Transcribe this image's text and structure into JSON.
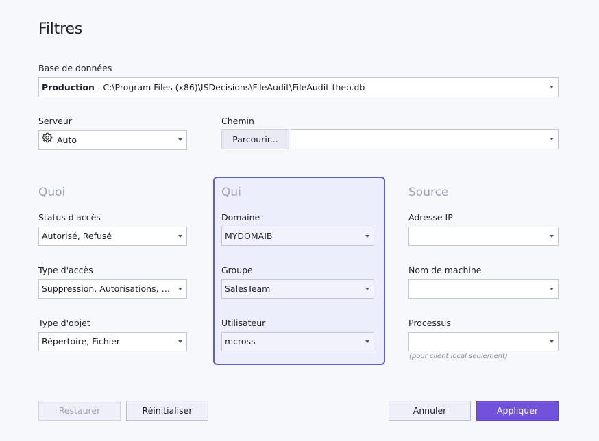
{
  "window": {
    "title": "Filtres"
  },
  "database": {
    "label": "Base de données",
    "name": "Production",
    "separator": " - ",
    "path": "C:\\Program Files (x86)\\ISDecisions\\FileAudit\\FileAudit-theo.db"
  },
  "server": {
    "label": "Serveur",
    "value": "Auto",
    "icon": "gear-icon"
  },
  "path": {
    "label": "Chemin",
    "browse_label": "Parcourir...",
    "value": ""
  },
  "quoi": {
    "title": "Quoi",
    "access_status": {
      "label": "Status d'accès",
      "value": "Autorisé, Refusé"
    },
    "access_type": {
      "label": "Type d'accès",
      "value": "Suppression, Autorisations, Ecriture"
    },
    "object_type": {
      "label": "Type d'objet",
      "value": "Répertoire, Fichier"
    }
  },
  "qui": {
    "title": "Qui",
    "domain": {
      "label": "Domaine",
      "value": "MYDOMAIB"
    },
    "group": {
      "label": "Groupe",
      "value": "SalesTeam"
    },
    "user": {
      "label": "Utilisateur",
      "value": "mcross"
    }
  },
  "source": {
    "title": "Source",
    "ip": {
      "label": "Adresse IP",
      "value": ""
    },
    "machine": {
      "label": "Nom de machine",
      "value": ""
    },
    "process": {
      "label": "Processus",
      "value": "",
      "hint": "(pour client local seulement)"
    }
  },
  "buttons": {
    "restore": "Restaurer",
    "reset": "Réinitialiser",
    "cancel": "Annuler",
    "apply": "Appliquer"
  },
  "colors": {
    "accent": "#7152db",
    "panel_border": "#5c5fc9",
    "section_title": "#9aa1b8"
  }
}
